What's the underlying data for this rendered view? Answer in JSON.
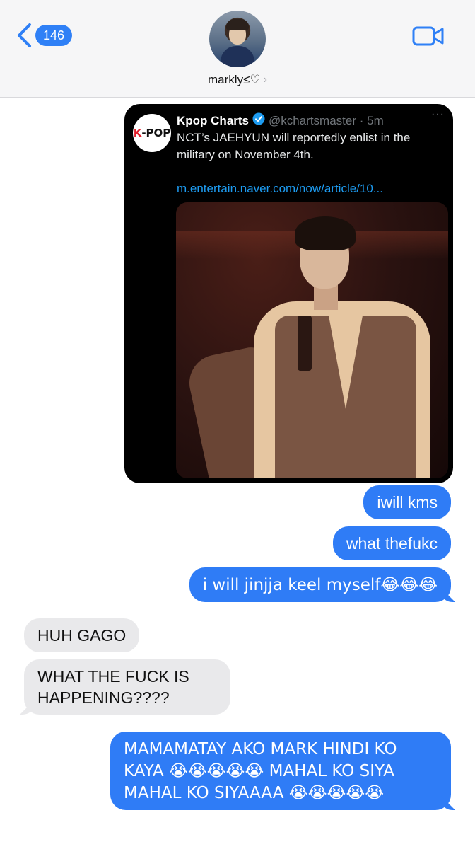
{
  "header": {
    "unread_count": "146",
    "contact_name": "markly",
    "contact_suffix": "≤♡",
    "chevron": "›",
    "icons": {
      "back": "chevron-left-icon",
      "video": "video-camera-icon"
    }
  },
  "tweet": {
    "author": "Kpop Charts",
    "handle_time": "@kchartsmaster · 5m",
    "text": "NCT’s JAEHYUN will reportedly enlist in the military on November 4th.",
    "link": "m.entertain.naver.com/now/article/10...",
    "more": "···",
    "logo_k": "K",
    "logo_pop": "-POP"
  },
  "messages": [
    {
      "direction": "sent",
      "text": "iwill kms"
    },
    {
      "direction": "sent",
      "text": "what thefukc"
    },
    {
      "direction": "sent",
      "text": "i will jinjja keel myself😂😂😂"
    },
    {
      "direction": "received",
      "text": "HUH GAGO"
    },
    {
      "direction": "received",
      "text": "WHAT THE FUCK IS HAPPENING????"
    },
    {
      "direction": "sent",
      "text": "MAMAMATAY AKO MARK HINDI KO KAYA 😭😭😭😭😭 MAHAL KO SIYA MAHAL KO SIYAAAA 😭😭😭😭😭"
    }
  ],
  "colors": {
    "sent_bubble": "#2f7cf6",
    "received_bubble": "#e9e9eb",
    "accent": "#2f80f6",
    "tweet_link": "#1d9bf0"
  }
}
